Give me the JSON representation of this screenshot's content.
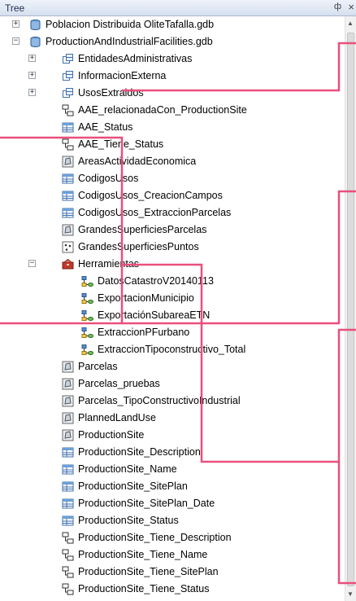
{
  "panel": {
    "title": "Tree",
    "pin_glyph": "ф",
    "close_glyph": "×"
  },
  "colors": {
    "highlight": "#e94f7d",
    "folder": "#3f6fae",
    "db": "#6aa0d8",
    "tool": "#c0392b"
  },
  "tree": {
    "items": [
      {
        "label": "Poblacion Distribuida OliteTafalla.gdb",
        "level": 0,
        "icon": "geodatabase-icon",
        "expander": "+"
      },
      {
        "label": "ProductionAndIndustrialFacilities.gdb",
        "level": 0,
        "icon": "geodatabase-icon",
        "expander": "−"
      },
      {
        "label": "EntidadesAdministrativas",
        "level": 1,
        "icon": "feature-dataset-icon",
        "expander": "+"
      },
      {
        "label": "InformacionExterna",
        "level": 1,
        "icon": "feature-dataset-icon",
        "expander": "+"
      },
      {
        "label": "UsosExtraidos",
        "level": 1,
        "icon": "feature-dataset-icon",
        "expander": "+"
      },
      {
        "label": "AAE_relacionadaCon_ProductionSite",
        "level": 1,
        "icon": "relationship-class-icon",
        "expander": ""
      },
      {
        "label": "AAE_Status",
        "level": 1,
        "icon": "table-icon",
        "expander": ""
      },
      {
        "label": "AAE_Tiene_Status",
        "level": 1,
        "icon": "relationship-class-icon",
        "expander": ""
      },
      {
        "label": "AreasActividadEconomica",
        "level": 1,
        "icon": "polygon-feature-class-icon",
        "expander": ""
      },
      {
        "label": "CodigosUsos",
        "level": 1,
        "icon": "table-icon",
        "expander": ""
      },
      {
        "label": "CodigosUsos_CreacionCampos",
        "level": 1,
        "icon": "table-icon",
        "expander": ""
      },
      {
        "label": "CodigosUsos_ExtraccionParcelas",
        "level": 1,
        "icon": "table-icon",
        "expander": ""
      },
      {
        "label": "GrandesSuperficiesParcelas",
        "level": 1,
        "icon": "polygon-feature-class-icon",
        "expander": ""
      },
      {
        "label": "GrandesSuperficiesPuntos",
        "level": 1,
        "icon": "point-feature-class-icon",
        "expander": ""
      },
      {
        "label": "Herramientas",
        "level": 1,
        "icon": "toolbox-icon",
        "expander": "−"
      },
      {
        "label": "DatosCatastroV20140113",
        "level": 2,
        "icon": "model-tool-icon",
        "expander": ""
      },
      {
        "label": "ExportacionMunicipio",
        "level": 2,
        "icon": "model-tool-icon",
        "expander": ""
      },
      {
        "label": "ExportaciónSubareaETN",
        "level": 2,
        "icon": "model-tool-icon",
        "expander": ""
      },
      {
        "label": "ExtraccionPFurbano",
        "level": 2,
        "icon": "model-tool-icon",
        "expander": ""
      },
      {
        "label": "ExtraccionTipoconstructivo_Total",
        "level": 2,
        "icon": "model-tool-icon",
        "expander": ""
      },
      {
        "label": "Parcelas",
        "level": 1,
        "icon": "polygon-feature-class-icon",
        "expander": ""
      },
      {
        "label": "Parcelas_pruebas",
        "level": 1,
        "icon": "polygon-feature-class-icon",
        "expander": ""
      },
      {
        "label": "Parcelas_TipoConstructivoIndustrial",
        "level": 1,
        "icon": "polygon-feature-class-icon",
        "expander": ""
      },
      {
        "label": "PlannedLandUse",
        "level": 1,
        "icon": "polygon-feature-class-icon",
        "expander": ""
      },
      {
        "label": "ProductionSite",
        "level": 1,
        "icon": "polygon-feature-class-icon",
        "expander": ""
      },
      {
        "label": "ProductionSite_Description",
        "level": 1,
        "icon": "table-icon",
        "expander": ""
      },
      {
        "label": "ProductionSite_Name",
        "level": 1,
        "icon": "table-icon",
        "expander": ""
      },
      {
        "label": "ProductionSite_SitePlan",
        "level": 1,
        "icon": "table-icon",
        "expander": ""
      },
      {
        "label": "ProductionSite_SitePlan_Date",
        "level": 1,
        "icon": "table-icon",
        "expander": ""
      },
      {
        "label": "ProductionSite_Status",
        "level": 1,
        "icon": "table-icon",
        "expander": ""
      },
      {
        "label": "ProductionSite_Tiene_Description",
        "level": 1,
        "icon": "relationship-class-icon",
        "expander": ""
      },
      {
        "label": "ProductionSite_Tiene_Name",
        "level": 1,
        "icon": "relationship-class-icon",
        "expander": ""
      },
      {
        "label": "ProductionSite_Tiene_SitePlan",
        "level": 1,
        "icon": "relationship-class-icon",
        "expander": ""
      },
      {
        "label": "ProductionSite_Tiene_Status",
        "level": 1,
        "icon": "relationship-class-icon",
        "expander": ""
      }
    ]
  }
}
